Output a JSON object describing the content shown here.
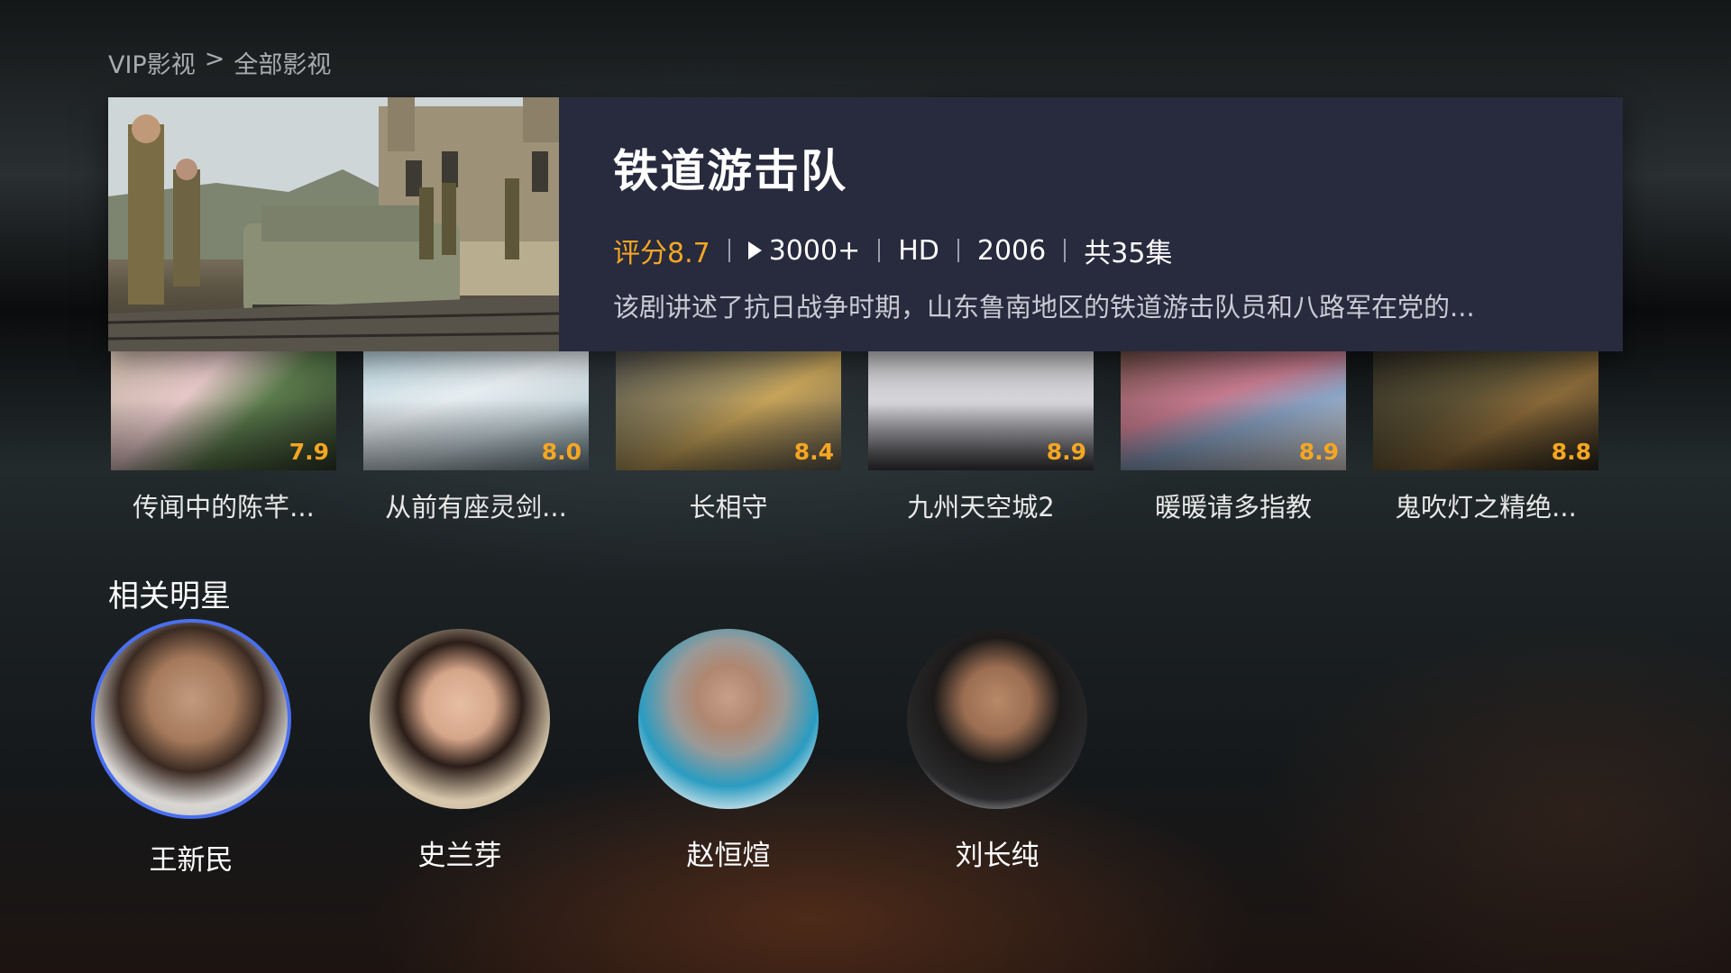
{
  "breadcrumb": {
    "parent": "VIP影视",
    "separator": ">",
    "current": "全部影视"
  },
  "hero": {
    "title": "铁道游击队",
    "rating": "评分8.7",
    "plays": "3000+",
    "quality": "HD",
    "year": "2006",
    "episodes": "共35集",
    "description": "该剧讲述了抗日战争时期，山东鲁南地区的铁道游击队员和八路军在党的...",
    "icons": [
      "play-icon"
    ],
    "colors": {
      "rating": "#f5a623",
      "card_bg": "#282a3e"
    }
  },
  "recommendations": [
    {
      "title": "传闻中的陈芊...",
      "rating": "7.9"
    },
    {
      "title": "从前有座灵剑...",
      "rating": "8.0"
    },
    {
      "title": "长相守",
      "rating": "8.4"
    },
    {
      "title": "九州天空城2",
      "rating": "8.9"
    },
    {
      "title": "暖暖请多指教",
      "rating": "8.9"
    },
    {
      "title": "鬼吹灯之精绝...",
      "rating": "8.8"
    }
  ],
  "stars_section": {
    "title": "相关明星",
    "items": [
      {
        "name": "王新民",
        "focused": true
      },
      {
        "name": "史兰芽"
      },
      {
        "name": "赵恒煊"
      },
      {
        "name": "刘长纯"
      }
    ]
  },
  "colors": {
    "focus_ring": "#4a6ff0"
  }
}
